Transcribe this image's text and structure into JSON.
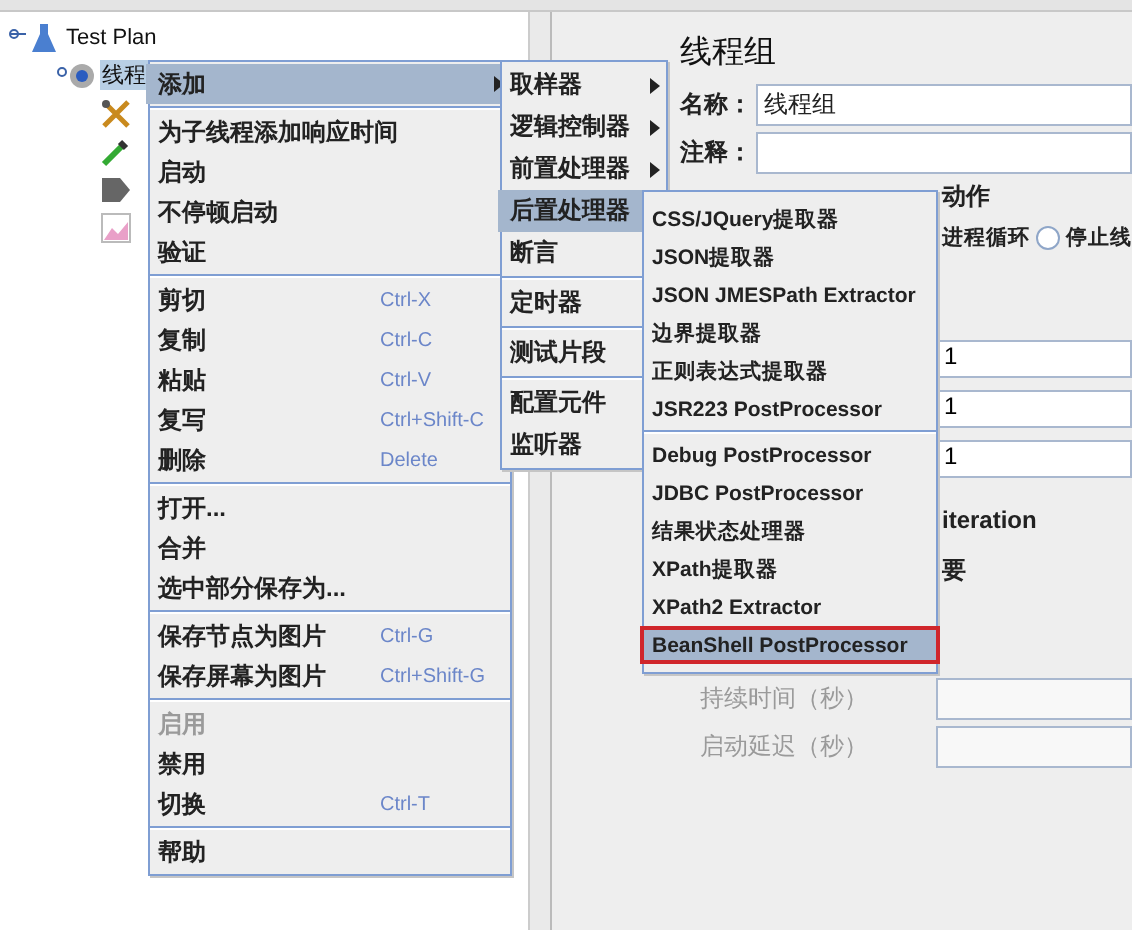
{
  "tree": {
    "label": "Test Plan",
    "children": [
      {
        "label": "线程",
        "selected": true,
        "children": [
          {
            "kind": "tools"
          },
          {
            "kind": "dropper"
          },
          {
            "kind": "tag"
          },
          {
            "kind": "chart"
          }
        ]
      }
    ]
  },
  "panel": {
    "title": "线程组",
    "name_label": "名称：",
    "name_value": "线程组",
    "comment_label": "注释：",
    "group_title_fragment": "动作",
    "radio_fragment": "进程循环",
    "radios": [
      {
        "label": "停止线",
        "selected": false
      }
    ],
    "number_fields": [
      "1",
      "1",
      "1"
    ],
    "fragments": [
      "iteration",
      "要"
    ],
    "timing": [
      {
        "label": "持续时间（秒）",
        "disabled": true
      },
      {
        "label": "启动延迟（秒）",
        "disabled": true
      }
    ]
  },
  "context_menu": {
    "groups": [
      [
        {
          "label": "添加",
          "submenu": true,
          "selected": true
        }
      ],
      [
        {
          "label": "为子线程添加响应时间",
          "selected": false
        },
        {
          "label": "启动",
          "selected": false
        },
        {
          "label": "不停顿启动",
          "selected": false
        },
        {
          "label": "验证",
          "selected": false
        }
      ],
      [
        {
          "label": "剪切",
          "shortcut": "Ctrl-X",
          "selected": false
        },
        {
          "label": "复制",
          "shortcut": "Ctrl-C",
          "selected": false
        },
        {
          "label": "粘贴",
          "shortcut": "Ctrl-V",
          "selected": false
        },
        {
          "label": "复写",
          "shortcut": "Ctrl+Shift-C",
          "selected": false
        },
        {
          "label": "删除",
          "shortcut": "Delete",
          "selected": false
        }
      ],
      [
        {
          "label": "打开...",
          "selected": false
        },
        {
          "label": "合并",
          "selected": false
        },
        {
          "label": "选中部分保存为...",
          "selected": false
        }
      ],
      [
        {
          "label": "保存节点为图片",
          "shortcut": "Ctrl-G",
          "selected": false
        },
        {
          "label": "保存屏幕为图片",
          "shortcut": "Ctrl+Shift-G",
          "selected": false
        }
      ],
      [
        {
          "label": "启用",
          "selected": false,
          "disabled": true
        },
        {
          "label": "禁用",
          "selected": false,
          "disabled": false
        },
        {
          "label": "切换",
          "shortcut": "Ctrl-T",
          "selected": false
        }
      ],
      [
        {
          "label": "帮助",
          "selected": false
        }
      ]
    ]
  },
  "add_submenu": {
    "groups": [
      [
        {
          "label": "取样器",
          "submenu": true,
          "selected": false
        },
        {
          "label": "逻辑控制器",
          "submenu": true,
          "selected": false
        },
        {
          "label": "前置处理器",
          "submenu": true,
          "selected": false
        },
        {
          "label": "后置处理器",
          "submenu": true,
          "selected": true
        },
        {
          "label": "断言",
          "submenu": true,
          "selected": false
        }
      ],
      [
        {
          "label": "定时器",
          "submenu": true,
          "selected": false
        }
      ],
      [
        {
          "label": "测试片段",
          "submenu": true,
          "selected": false
        }
      ],
      [
        {
          "label": "配置元件",
          "submenu": true,
          "selected": false
        },
        {
          "label": "监听器",
          "submenu": true,
          "selected": false
        }
      ]
    ]
  },
  "post_processor_submenu": {
    "groups": [
      [
        {
          "label": "CSS/JQuery提取器",
          "selected": false
        },
        {
          "label": "JSON提取器",
          "selected": false
        },
        {
          "label": "JSON JMESPath Extractor",
          "selected": false
        },
        {
          "label": "边界提取器",
          "selected": false
        },
        {
          "label": "正则表达式提取器",
          "selected": false
        },
        {
          "label": "JSR223 PostProcessor",
          "selected": false
        }
      ],
      [
        {
          "label": "Debug PostProcessor",
          "selected": false
        },
        {
          "label": "JDBC PostProcessor",
          "selected": false
        },
        {
          "label": "结果状态处理器",
          "selected": false
        },
        {
          "label": "XPath提取器",
          "selected": false
        },
        {
          "label": "XPath2 Extractor",
          "selected": false
        },
        {
          "label": "BeanShell PostProcessor",
          "selected": true,
          "outlined": true
        }
      ]
    ]
  }
}
